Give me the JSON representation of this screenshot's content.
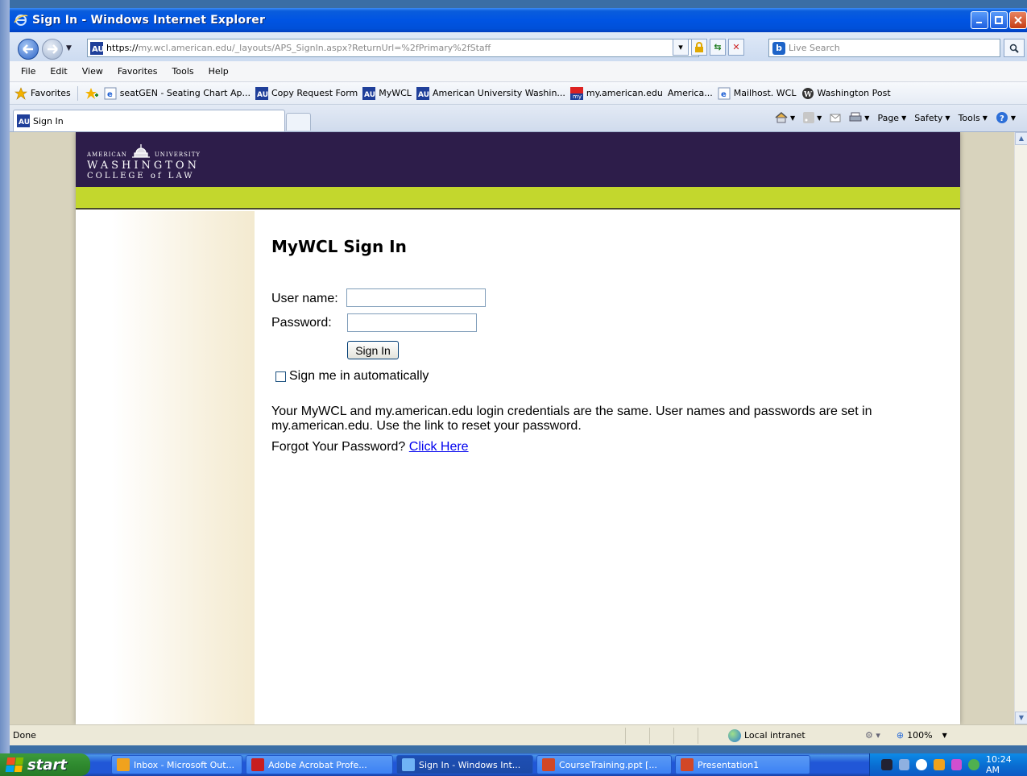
{
  "window": {
    "title": "Sign In - Windows Internet Explorer"
  },
  "address": {
    "url_scheme": "https://",
    "url_rest": "my.wcl.american.edu/_layouts/APS_SignIn.aspx?ReturnUrl=%2fPrimary%2fStaff",
    "search_placeholder": "Live Search"
  },
  "menu": [
    "File",
    "Edit",
    "View",
    "Favorites",
    "Tools",
    "Help"
  ],
  "favorites": {
    "label": "Favorites",
    "items": [
      "seatGEN - Seating Chart Ap...",
      "Copy Request Form",
      "MyWCL",
      "American University Washin...",
      "my.american.edu",
      "America...",
      "Mailhost. WCL",
      "Washington Post"
    ]
  },
  "tab": {
    "label": "Sign In"
  },
  "commands": {
    "page": "Page",
    "safety": "Safety",
    "tools": "Tools"
  },
  "logo": {
    "line1a": "AMERICAN",
    "line1b": "UNIVERSITY",
    "line2": "WASHINGTON",
    "line3": "COLLEGE of LAW"
  },
  "signin": {
    "heading": "MyWCL Sign In",
    "username_label": "User name:",
    "username_value": "",
    "password_label": "Password:",
    "password_value": "",
    "button": "Sign In",
    "remember": "Sign me in automatically",
    "remember_checked": false,
    "info": "Your MyWCL and my.american.edu login credentials are the same. User names and passwords are set in my.american.edu. Use the link to reset your password.",
    "forgot_prefix": "Forgot Your Password?",
    "forgot_link": "Click Here"
  },
  "status": {
    "text": "Done",
    "zone": "Local intranet",
    "zoom": "100%"
  },
  "taskbar": {
    "start": "start",
    "items": [
      "Inbox - Microsoft Out...",
      "Adobe Acrobat Profe...",
      "Sign In - Windows Int...",
      "CourseTraining.ppt [...",
      "Presentation1"
    ],
    "clock": "10:24 AM"
  },
  "colors": {
    "banner": "#2d1d4a",
    "accent_green": "#c3d72d",
    "link": "#0000ee"
  }
}
